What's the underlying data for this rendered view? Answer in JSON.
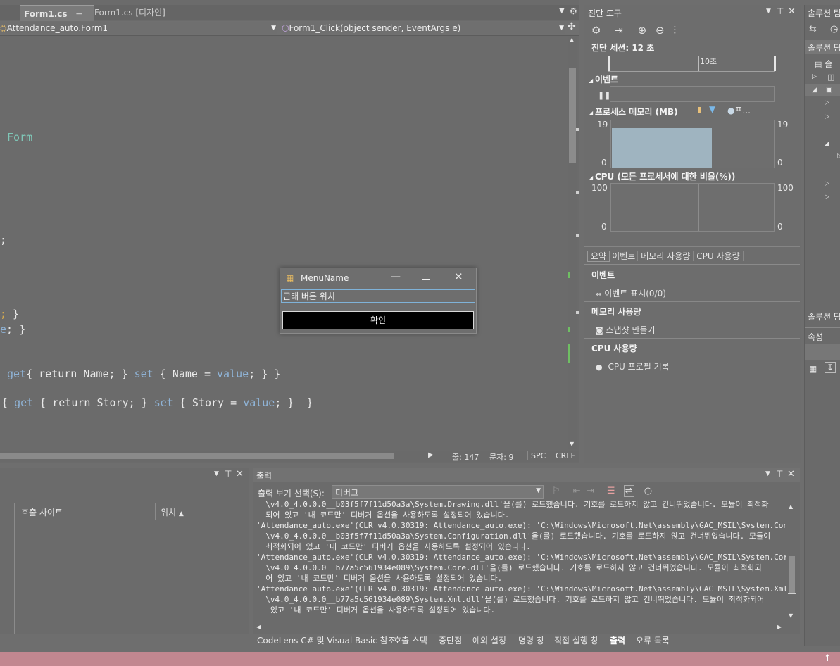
{
  "editor": {
    "tabs": [
      {
        "label": "Form1.cs",
        "active": true
      },
      {
        "label": "Form1.cs [디자인]",
        "active": false
      }
    ],
    "class_combo": "Attendance_auto.Form1",
    "member_combo": "Form1_Click(object sender, EventArgs e)",
    "code_lines": {
      "form": "Form",
      "semi": ";",
      "brace1": "; }",
      "brace2_e": "e",
      "brace2_rest": "; }",
      "name_line": {
        "kw1": "get",
        "t1": "{ return Name; } ",
        "kw2": "set",
        "t2": " { Name = ",
        "kw3": "value",
        "t3": "; } }"
      },
      "story_line": {
        "t0": "{ ",
        "kw1": "get",
        "t1": " { return Story; } ",
        "kw2": "set",
        "t2": " { Story = ",
        "kw3": "value",
        "t3": "; }  }"
      }
    },
    "status": {
      "line": "줄: 147",
      "col": "문자: 9",
      "spc": "SPC",
      "crlf": "CRLF"
    }
  },
  "diagnostics": {
    "title": "진단 도구",
    "session": "진단 세션: 12 초",
    "timeline_label": "10초",
    "events_header": "이벤트",
    "memory_header": "프로세스 메모리 (MB)",
    "memory_legend": "프...",
    "memory_max": "19",
    "memory_min": "0",
    "memory_fill_fraction": 0.62,
    "cpu_header": "CPU (모든 프로세서에 대한 비율(%))",
    "cpu_max": "100",
    "cpu_min": "0",
    "tabs": [
      "요약",
      "이벤트",
      "메모리 사용량",
      "CPU 사용량"
    ],
    "summary": {
      "events_h": "이벤트",
      "events_item": "이벤트 표시(0/0)",
      "memory_h": "메모리 사용량",
      "memory_item": "스냅샷 만들기",
      "cpu_h": "CPU 사용량",
      "cpu_item": "CPU 프로필 기록"
    }
  },
  "solution": {
    "title": "솔루션 탐",
    "title2": "솔루션 탐",
    "item": "솔",
    "title3": "솔루션 탐",
    "props": "속성"
  },
  "callstack": {
    "col_site": "호출 사이트",
    "col_pos": "위치"
  },
  "output": {
    "title": "출력",
    "select_label": "출력 보기 선택(S):",
    "select_value": "디버그",
    "lines": [
      "  \\v4.0_4.0.0.0__b03f5f7f11d50a3a\\System.Drawing.dll'을(를) 로드했습니다. 기호를 로드하지 않고 건너뛰었습니다. 모듈이 최적화",
      "  되어 있고 '내 코드만' 디버거 옵션을 사용하도록 설정되어 있습니다.",
      "'Attendance_auto.exe'(CLR v4.0.30319: Attendance_auto.exe): 'C:\\Windows\\Microsoft.Net\\assembly\\GAC_MSIL\\System.Configuration",
      "  \\v4.0_4.0.0.0__b03f5f7f11d50a3a\\System.Configuration.dll'을(를) 로드했습니다. 기호를 로드하지 않고 건너뛰었습니다. 모듈이",
      "  최적화되어 있고 '내 코드만' 디버거 옵션을 사용하도록 설정되어 있습니다.",
      "'Attendance_auto.exe'(CLR v4.0.30319: Attendance_auto.exe): 'C:\\Windows\\Microsoft.Net\\assembly\\GAC_MSIL\\System.Core",
      "  \\v4.0_4.0.0.0__b77a5c561934e089\\System.Core.dll'을(를) 로드했습니다. 기호를 로드하지 않고 건너뛰었습니다. 모듈이 최적화되",
      "  어 있고 '내 코드만' 디버거 옵션을 사용하도록 설정되어 있습니다.",
      "'Attendance_auto.exe'(CLR v4.0.30319: Attendance_auto.exe): 'C:\\Windows\\Microsoft.Net\\assembly\\GAC_MSIL\\System.Xml",
      "  \\v4.0_4.0.0.0__b77a5c561934e089\\System.Xml.dll'을(를) 로드했습니다. 기호를 로드하지 않고 건너뛰었습니다. 모듈이 최적화되어",
      "   있고 '내 코드만' 디버거 옵션을 사용하도록 설정되어 있습니다."
    ]
  },
  "bottom_tabs": [
    "CodeLens C# 및 Visual Basic 참조",
    "호출 스택",
    "중단점",
    "예외 설정",
    "명령 창",
    "직접 실행 창",
    "출력",
    "오류 목록"
  ],
  "dialog": {
    "title": "MenuName",
    "input_value": "근태 버튼 위치",
    "button": "확인"
  }
}
